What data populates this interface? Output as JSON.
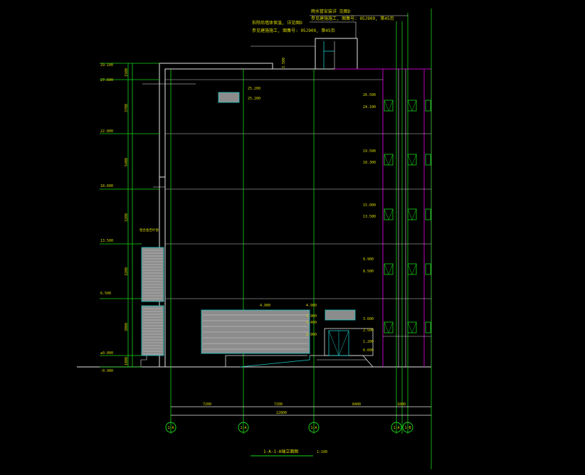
{
  "colors": {
    "background": "#000000",
    "line_white": "#e6e6e6",
    "line_green": "#19d419",
    "line_magenta": "#c000c0",
    "line_cyan": "#19c8c8",
    "fill_gray": "#8c8c8c",
    "text_yellow": "#d8d800",
    "text_white": "#e0e0e0"
  },
  "notes": {
    "note_1": "雨水管安装详 见图D",
    "note_2": "参见建施施工, 图集号: 05J909, 第45页",
    "note_3": "拆除后墙体保温, 详见图D",
    "note_4": "参见建施施工, 图集号: 05J909, 第45页"
  },
  "left_levels": [
    "29.100",
    "27.600",
    "22.800",
    "18.600",
    "13.500",
    "6.500",
    "±0.000",
    "-0.900"
  ],
  "left_dims": [
    "1500",
    "3700",
    "5400",
    "3200",
    "3200",
    "3000",
    "1000"
  ],
  "stair_label": "铝合金百叶窗",
  "mid_labels": {
    "sign_top": "25.200",
    "sign_bottom": "25.200",
    "door_level": "3.500"
  },
  "panel_labels": [
    "4.900",
    "4.900",
    "3.900",
    "3.400",
    "2.900"
  ],
  "right_levels": [
    "26.500",
    "24.100",
    "19.500",
    "18.300",
    "15.000",
    "13.500",
    "9.900",
    "8.500",
    "3.600",
    "2.500",
    "1.200",
    "0.600"
  ],
  "bottom_dims": {
    "d1": "7200",
    "d2": "7200",
    "d3": "8400",
    "d4": "1800",
    "total": "22800"
  },
  "axis_labels": [
    "1-A",
    "1-A",
    "1-A",
    "1-A",
    "1-B"
  ],
  "title": "1-A-1-A轴立面图",
  "scale": "1:100"
}
